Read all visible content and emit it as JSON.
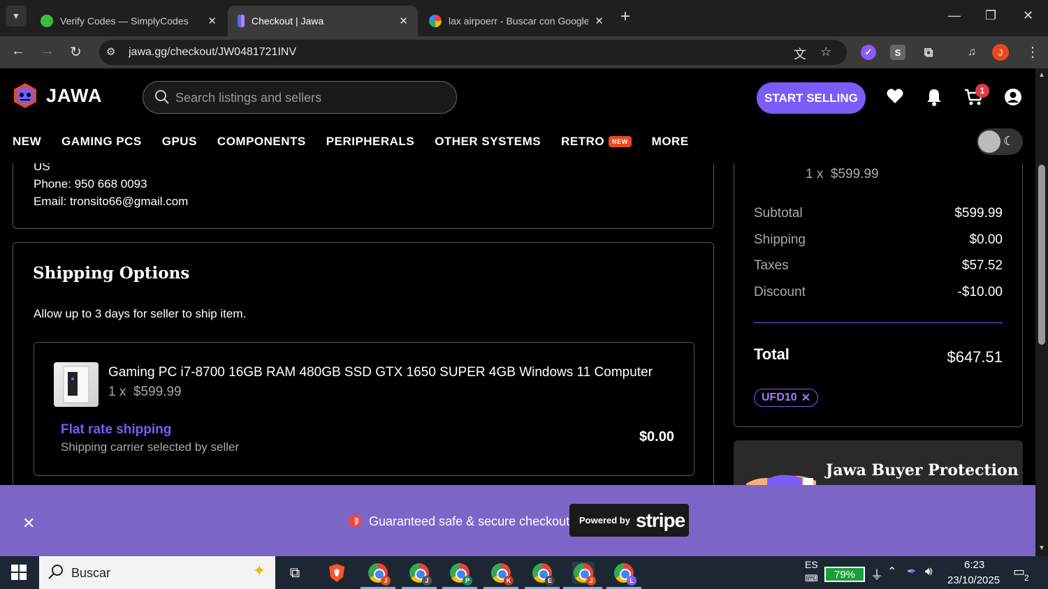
{
  "browser": {
    "tabs": [
      {
        "title": "Verify Codes — SimplyCodes",
        "active": false
      },
      {
        "title": "Checkout | Jawa",
        "active": true
      },
      {
        "title": "lax airpoerr - Buscar con Google",
        "active": false
      }
    ],
    "url": "jawa.gg/checkout/JW0481721INV",
    "profile_initial": "J",
    "ext_s": "S"
  },
  "site": {
    "logo_text": "JAWA",
    "search_placeholder": "Search listings and sellers",
    "start_selling": "START SELLING",
    "cart_count": "1",
    "nav": [
      "NEW",
      "GAMING PCS",
      "GPUS",
      "COMPONENTS",
      "PERIPHERALS",
      "OTHER SYSTEMS",
      "RETRO",
      "MORE"
    ],
    "retro_badge": "NEW"
  },
  "address": {
    "country": "US",
    "phone": "Phone: 950 668 0093",
    "email": "Email: tronsito66@gmail.com"
  },
  "shipping": {
    "title": "Shipping Options",
    "description": "Allow up to 3 days for seller to ship item.",
    "item_title": "Gaming PC i7-8700 16GB RAM 480GB SSD GTX 1650 SUPER 4GB Windows 11 Computer",
    "item_qty": "1 x",
    "item_price": "$599.99",
    "rate_name": "Flat rate shipping",
    "rate_sub": "Shipping carrier selected by seller",
    "rate_price": "$0.00"
  },
  "summary": {
    "qty": "1 x",
    "qty_price": "$599.99",
    "rows": [
      {
        "label": "Subtotal",
        "value": "$599.99"
      },
      {
        "label": "Shipping",
        "value": "$0.00"
      },
      {
        "label": "Taxes",
        "value": "$57.52"
      },
      {
        "label": "Discount",
        "value": "-$10.00"
      }
    ],
    "total_label": "Total",
    "total_value": "$647.51",
    "coupon": "UFD10"
  },
  "protection": {
    "title": "Jawa Buyer Protection"
  },
  "banner": {
    "secure_text": "Guaranteed safe & secure checkout",
    "powered_by": "Powered by",
    "stripe": "stripe"
  },
  "taskbar": {
    "search_text": "Buscar",
    "lang": "ES",
    "battery": "79%",
    "time": "6:23",
    "date": "23/10/2025",
    "notifications": "2",
    "app_tags": [
      "J",
      "J",
      "P",
      "K",
      "E",
      "J",
      "L"
    ]
  },
  "colors": {
    "accent": "#7a5cf6",
    "banner": "#7b66c8",
    "badge": "#e23a4b",
    "brand_orange": "#e84a1e"
  }
}
